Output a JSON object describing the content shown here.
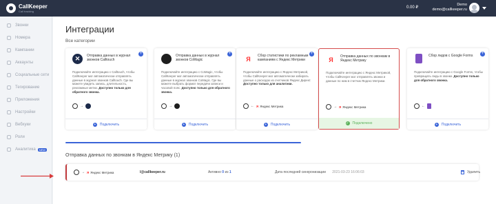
{
  "header": {
    "brand": "CallKeeper",
    "brand_sub": "Call tracking",
    "balance": "0.00 ₽",
    "user_name": "Demo",
    "user_email": "demo@callkeeper.ru"
  },
  "sidebar": {
    "items": [
      {
        "label": "Звонки",
        "icon": "phone-icon"
      },
      {
        "label": "Номера",
        "icon": "hash-icon"
      },
      {
        "label": "Кампании",
        "icon": "campaign-icon"
      },
      {
        "label": "Аккаунты",
        "icon": "accounts-icon"
      },
      {
        "label": "Социальные сети",
        "icon": "social-icon"
      },
      {
        "label": "Тегирование",
        "icon": "tag-icon"
      },
      {
        "label": "Приложения",
        "icon": "apps-icon"
      },
      {
        "label": "Настройки",
        "icon": "gear-icon"
      },
      {
        "label": "Вебхуки",
        "icon": "webhook-icon"
      },
      {
        "label": "Роли",
        "icon": "roles-icon"
      },
      {
        "label": "Аналитика",
        "icon": "analytics-icon",
        "badge": "NEW"
      }
    ]
  },
  "main": {
    "title": "Интеграции",
    "section_label": "Все категории",
    "connect_label": "Подключить",
    "connected_label": "Подключено",
    "cards": [
      {
        "title": "Отправка данных в журнал звонков Calltouch",
        "desc": "Подключайте интеграцию с Calltouch, чтобы CallKeeper мог автоматически отправлять данные в журнал звонков Calltouch. Где вы можете увидеть запись, длительность, рекламные метки.",
        "desc_bold": "Доступно только для обратного звонка.",
        "flow_target": "",
        "brand_color": "#1c2a4a",
        "state": "connect"
      },
      {
        "title": "Отправка данных в журнал звонков CoMagic",
        "desc": "Подключайте интеграцию с CoMagic, чтобы CallKeeper мог автоматически отправлять данные в журнал звонков CoMagic. Где вы можете выбрать формат передачи записи и часовой пояс.",
        "desc_bold": "Доступно только для обратного звонка.",
        "flow_target": "",
        "brand_color": "#1e1e1e",
        "state": "connect"
      },
      {
        "title": "Сбор статистики по рекламным кампаниям с Яндекс Метрики",
        "desc": "Подключайте интеграцию с Яндекс Метрикой, чтобы CallKeeper мог автоматически забирать данные о расходах из счетчиков Яндекс Директ.",
        "desc_bold": "Доступно только для аналитики.",
        "flow_target": "Яндекс Метрика",
        "brand_color": "#ff3333",
        "state": "connect"
      },
      {
        "title": "Отправка данных по звонкам в Яндекс Метрику",
        "desc": "Подключайте интеграцию с Яндекс Метрикой, чтобы CallKeeper мог отправлять звонки и данные по ним в счетчик Яндекс Метрики.",
        "desc_bold": "",
        "flow_target": "Яндекс Метрика",
        "brand_color": "#ff3333",
        "state": "connected"
      },
      {
        "title": "Сбор лидов с Google Forms",
        "desc": "Подключайте интеграцию с Google Forms, чтобы превращать лиды в звонки.",
        "desc_bold": "Доступно только для обратного звонка.",
        "flow_target": "",
        "brand_color": "#7e4fc3",
        "state": "connect"
      }
    ],
    "subsection_title": "Отправка данных по звонкам в Яндекс Метрику (1)",
    "row": {
      "flow_target": "Яндекс Метрика",
      "email": "l@callkeeper.ru",
      "status_label": "Активно",
      "status_active": "0",
      "status_sep": "из",
      "status_total": "1",
      "sync_label": "Дата последней синхронизации",
      "sync_time": "2021-03-23 16:06:03",
      "delete_label": "Удалить"
    }
  },
  "colors": {
    "accent": "#3a64d8",
    "active_border": "#d54b4b",
    "connected_bg": "#e7f6e4",
    "connected_text": "#5bb15a",
    "topbar": "#2a3346"
  }
}
